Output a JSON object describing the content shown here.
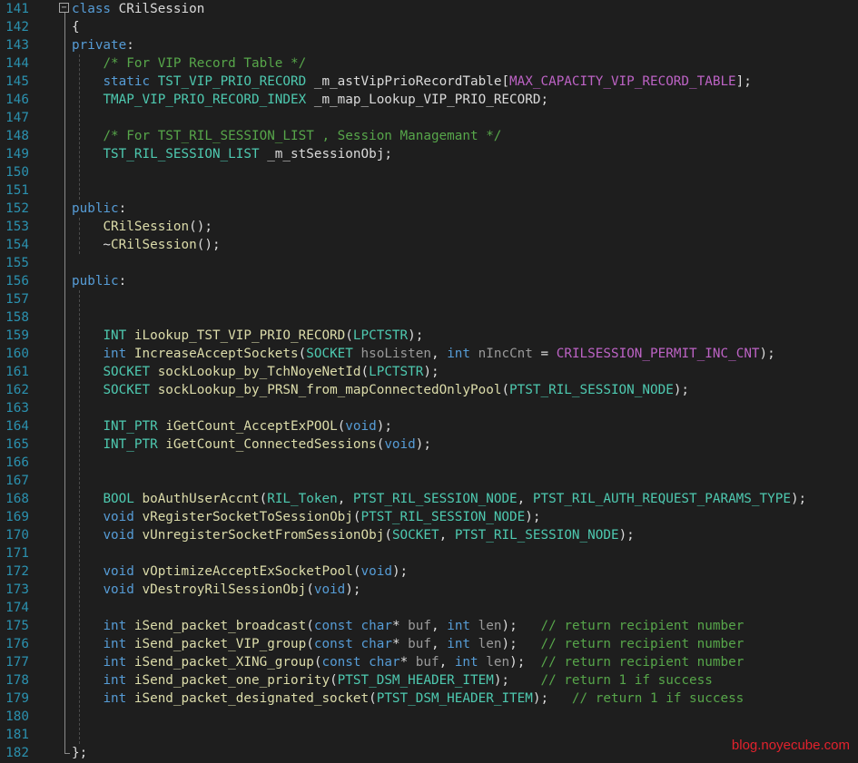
{
  "editor": {
    "lines": [
      {
        "n": "141",
        "t": [
          [
            "kw",
            "class"
          ],
          [
            "ident",
            " CRilSession"
          ]
        ]
      },
      {
        "n": "142",
        "t": [
          [
            "punc",
            "{"
          ]
        ]
      },
      {
        "n": "143",
        "t": [
          [
            "kw",
            "private"
          ],
          [
            "punc",
            ":"
          ]
        ]
      },
      {
        "n": "144",
        "t": [
          [
            "punc",
            "    "
          ],
          [
            "com",
            "/* For VIP Record Table */"
          ]
        ]
      },
      {
        "n": "145",
        "t": [
          [
            "punc",
            "    "
          ],
          [
            "kw",
            "static"
          ],
          [
            "punc",
            " "
          ],
          [
            "type",
            "TST_VIP_PRIO_RECORD"
          ],
          [
            "ident",
            " _m_astVipPrioRecordTable"
          ],
          [
            "punc",
            "["
          ],
          [
            "macro",
            "MAX_CAPACITY_VIP_RECORD_TABLE"
          ],
          [
            "punc",
            "];"
          ]
        ]
      },
      {
        "n": "146",
        "t": [
          [
            "punc",
            "    "
          ],
          [
            "type",
            "TMAP_VIP_PRIO_RECORD_INDEX"
          ],
          [
            "ident",
            " _m_map_Lookup_VIP_PRIO_RECORD"
          ],
          [
            "punc",
            ";"
          ]
        ]
      },
      {
        "n": "147",
        "t": []
      },
      {
        "n": "148",
        "t": [
          [
            "punc",
            "    "
          ],
          [
            "com",
            "/* For TST_RIL_SESSION_LIST , Session Managemant */"
          ]
        ]
      },
      {
        "n": "149",
        "t": [
          [
            "punc",
            "    "
          ],
          [
            "type",
            "TST_RIL_SESSION_LIST"
          ],
          [
            "ident",
            " _m_stSessionObj"
          ],
          [
            "punc",
            ";"
          ]
        ]
      },
      {
        "n": "150",
        "t": []
      },
      {
        "n": "151",
        "t": []
      },
      {
        "n": "152",
        "t": [
          [
            "kw",
            "public"
          ],
          [
            "punc",
            ":"
          ]
        ]
      },
      {
        "n": "153",
        "t": [
          [
            "punc",
            "    "
          ],
          [
            "func",
            "CRilSession"
          ],
          [
            "punc",
            "();"
          ]
        ]
      },
      {
        "n": "154",
        "t": [
          [
            "punc",
            "    ~"
          ],
          [
            "func",
            "CRilSession"
          ],
          [
            "punc",
            "();"
          ]
        ]
      },
      {
        "n": "155",
        "t": []
      },
      {
        "n": "156",
        "t": [
          [
            "kw",
            "public"
          ],
          [
            "punc",
            ":"
          ]
        ]
      },
      {
        "n": "157",
        "t": []
      },
      {
        "n": "158",
        "t": []
      },
      {
        "n": "159",
        "t": [
          [
            "punc",
            "    "
          ],
          [
            "type",
            "INT"
          ],
          [
            "punc",
            " "
          ],
          [
            "func",
            "iLookup_TST_VIP_PRIO_RECORD"
          ],
          [
            "punc",
            "("
          ],
          [
            "type",
            "LPCTSTR"
          ],
          [
            "punc",
            ");"
          ]
        ]
      },
      {
        "n": "160",
        "t": [
          [
            "punc",
            "    "
          ],
          [
            "kw",
            "int"
          ],
          [
            "punc",
            " "
          ],
          [
            "func",
            "IncreaseAcceptSockets"
          ],
          [
            "punc",
            "("
          ],
          [
            "type",
            "SOCKET"
          ],
          [
            "punc",
            " "
          ],
          [
            "param",
            "hsoListen"
          ],
          [
            "punc",
            ", "
          ],
          [
            "kw",
            "int"
          ],
          [
            "punc",
            " "
          ],
          [
            "param",
            "nIncCnt"
          ],
          [
            "punc",
            " = "
          ],
          [
            "macro",
            "CRILSESSION_PERMIT_INC_CNT"
          ],
          [
            "punc",
            ");"
          ]
        ]
      },
      {
        "n": "161",
        "t": [
          [
            "punc",
            "    "
          ],
          [
            "type",
            "SOCKET"
          ],
          [
            "punc",
            " "
          ],
          [
            "func",
            "sockLookup_by_TchNoyeNetId"
          ],
          [
            "punc",
            "("
          ],
          [
            "type",
            "LPCTSTR"
          ],
          [
            "punc",
            ");"
          ]
        ]
      },
      {
        "n": "162",
        "t": [
          [
            "punc",
            "    "
          ],
          [
            "type",
            "SOCKET"
          ],
          [
            "punc",
            " "
          ],
          [
            "func",
            "sockLookup_by_PRSN_from_mapConnectedOnlyPool"
          ],
          [
            "punc",
            "("
          ],
          [
            "type",
            "PTST_RIL_SESSION_NODE"
          ],
          [
            "punc",
            ");"
          ]
        ]
      },
      {
        "n": "163",
        "t": []
      },
      {
        "n": "164",
        "t": [
          [
            "punc",
            "    "
          ],
          [
            "type",
            "INT_PTR"
          ],
          [
            "punc",
            " "
          ],
          [
            "func",
            "iGetCount_AcceptExPOOL"
          ],
          [
            "punc",
            "("
          ],
          [
            "kw",
            "void"
          ],
          [
            "punc",
            ");"
          ]
        ]
      },
      {
        "n": "165",
        "t": [
          [
            "punc",
            "    "
          ],
          [
            "type",
            "INT_PTR"
          ],
          [
            "punc",
            " "
          ],
          [
            "func",
            "iGetCount_ConnectedSessions"
          ],
          [
            "punc",
            "("
          ],
          [
            "kw",
            "void"
          ],
          [
            "punc",
            ");"
          ]
        ]
      },
      {
        "n": "166",
        "t": []
      },
      {
        "n": "167",
        "t": []
      },
      {
        "n": "168",
        "t": [
          [
            "punc",
            "    "
          ],
          [
            "type",
            "BOOL"
          ],
          [
            "punc",
            " "
          ],
          [
            "func",
            "boAuthUserAccnt"
          ],
          [
            "punc",
            "("
          ],
          [
            "type",
            "RIL_Token"
          ],
          [
            "punc",
            ", "
          ],
          [
            "type",
            "PTST_RIL_SESSION_NODE"
          ],
          [
            "punc",
            ", "
          ],
          [
            "type",
            "PTST_RIL_AUTH_REQUEST_PARAMS_TYPE"
          ],
          [
            "punc",
            ");"
          ]
        ]
      },
      {
        "n": "169",
        "t": [
          [
            "punc",
            "    "
          ],
          [
            "kw",
            "void"
          ],
          [
            "punc",
            " "
          ],
          [
            "func",
            "vRegisterSocketToSessionObj"
          ],
          [
            "punc",
            "("
          ],
          [
            "type",
            "PTST_RIL_SESSION_NODE"
          ],
          [
            "punc",
            ");"
          ]
        ]
      },
      {
        "n": "170",
        "t": [
          [
            "punc",
            "    "
          ],
          [
            "kw",
            "void"
          ],
          [
            "punc",
            " "
          ],
          [
            "func",
            "vUnregisterSocketFromSessionObj"
          ],
          [
            "punc",
            "("
          ],
          [
            "type",
            "SOCKET"
          ],
          [
            "punc",
            ", "
          ],
          [
            "type",
            "PTST_RIL_SESSION_NODE"
          ],
          [
            "punc",
            ");"
          ]
        ]
      },
      {
        "n": "171",
        "t": []
      },
      {
        "n": "172",
        "t": [
          [
            "punc",
            "    "
          ],
          [
            "kw",
            "void"
          ],
          [
            "punc",
            " "
          ],
          [
            "func",
            "vOptimizeAcceptExSocketPool"
          ],
          [
            "punc",
            "("
          ],
          [
            "kw",
            "void"
          ],
          [
            "punc",
            ");"
          ]
        ]
      },
      {
        "n": "173",
        "t": [
          [
            "punc",
            "    "
          ],
          [
            "kw",
            "void"
          ],
          [
            "punc",
            " "
          ],
          [
            "func",
            "vDestroyRilSessionObj"
          ],
          [
            "punc",
            "("
          ],
          [
            "kw",
            "void"
          ],
          [
            "punc",
            ");"
          ]
        ]
      },
      {
        "n": "174",
        "t": []
      },
      {
        "n": "175",
        "t": [
          [
            "punc",
            "    "
          ],
          [
            "kw",
            "int"
          ],
          [
            "punc",
            " "
          ],
          [
            "func",
            "iSend_packet_broadcast"
          ],
          [
            "punc",
            "("
          ],
          [
            "kw",
            "const"
          ],
          [
            "punc",
            " "
          ],
          [
            "kw",
            "char"
          ],
          [
            "punc",
            "* "
          ],
          [
            "param",
            "buf"
          ],
          [
            "punc",
            ", "
          ],
          [
            "kw",
            "int"
          ],
          [
            "punc",
            " "
          ],
          [
            "param",
            "len"
          ],
          [
            "punc",
            ");   "
          ],
          [
            "com",
            "// return recipient number"
          ]
        ]
      },
      {
        "n": "176",
        "t": [
          [
            "punc",
            "    "
          ],
          [
            "kw",
            "int"
          ],
          [
            "punc",
            " "
          ],
          [
            "func",
            "iSend_packet_VIP_group"
          ],
          [
            "punc",
            "("
          ],
          [
            "kw",
            "const"
          ],
          [
            "punc",
            " "
          ],
          [
            "kw",
            "char"
          ],
          [
            "punc",
            "* "
          ],
          [
            "param",
            "buf"
          ],
          [
            "punc",
            ", "
          ],
          [
            "kw",
            "int"
          ],
          [
            "punc",
            " "
          ],
          [
            "param",
            "len"
          ],
          [
            "punc",
            ");   "
          ],
          [
            "com",
            "// return recipient number"
          ]
        ]
      },
      {
        "n": "177",
        "t": [
          [
            "punc",
            "    "
          ],
          [
            "kw",
            "int"
          ],
          [
            "punc",
            " "
          ],
          [
            "func",
            "iSend_packet_XING_group"
          ],
          [
            "punc",
            "("
          ],
          [
            "kw",
            "const"
          ],
          [
            "punc",
            " "
          ],
          [
            "kw",
            "char"
          ],
          [
            "punc",
            "* "
          ],
          [
            "param",
            "buf"
          ],
          [
            "punc",
            ", "
          ],
          [
            "kw",
            "int"
          ],
          [
            "punc",
            " "
          ],
          [
            "param",
            "len"
          ],
          [
            "punc",
            ");  "
          ],
          [
            "com",
            "// return recipient number"
          ]
        ]
      },
      {
        "n": "178",
        "t": [
          [
            "punc",
            "    "
          ],
          [
            "kw",
            "int"
          ],
          [
            "punc",
            " "
          ],
          [
            "func",
            "iSend_packet_one_priority"
          ],
          [
            "punc",
            "("
          ],
          [
            "type",
            "PTST_DSM_HEADER_ITEM"
          ],
          [
            "punc",
            ");    "
          ],
          [
            "com",
            "// return 1 if success"
          ]
        ]
      },
      {
        "n": "179",
        "t": [
          [
            "punc",
            "    "
          ],
          [
            "kw",
            "int"
          ],
          [
            "punc",
            " "
          ],
          [
            "func",
            "iSend_packet_designated_socket"
          ],
          [
            "punc",
            "("
          ],
          [
            "type",
            "PTST_DSM_HEADER_ITEM"
          ],
          [
            "punc",
            ");   "
          ],
          [
            "com",
            "// return 1 if success"
          ]
        ]
      },
      {
        "n": "180",
        "t": []
      },
      {
        "n": "181",
        "t": []
      },
      {
        "n": "182",
        "t": [
          [
            "punc",
            "};"
          ]
        ]
      }
    ]
  },
  "fold_glyph": "−",
  "watermark": "blog.noyecube.com",
  "colors": {
    "background": "#1e1e1e",
    "line_number": "#2b91af",
    "keyword": "#569cd6",
    "comment": "#57a64a",
    "type": "#4ec9b0",
    "macro": "#bd63c5",
    "function": "#dcdcaa",
    "watermark": "#e2222d"
  }
}
